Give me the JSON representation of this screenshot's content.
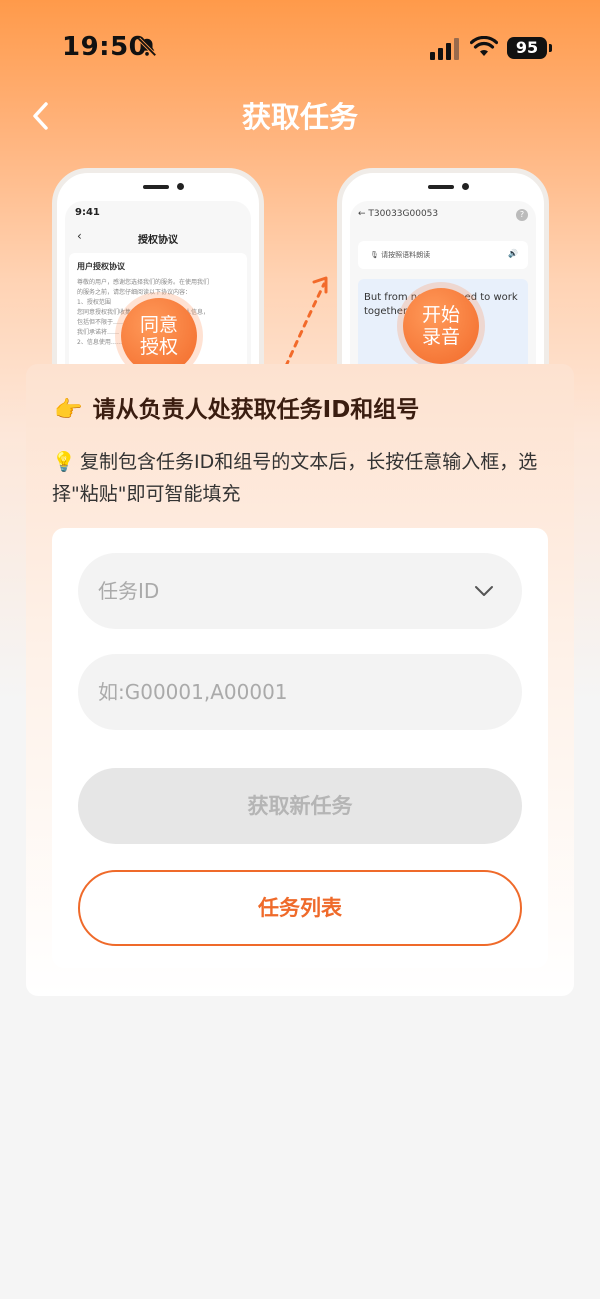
{
  "status_bar": {
    "time": "19:50",
    "battery": "95"
  },
  "nav": {
    "title": "获取任务"
  },
  "illustration": {
    "phone1": {
      "time": "9:41",
      "title": "授权协议",
      "card_heading": "用户授权协议",
      "card_text": [
        "尊敬的用户，感谢您选择我们的服务。在使用我们",
        "的服务之前，请您仔细阅读以下协议内容：",
        "1、授权范围",
        "您同意授权我们收集、使用和处理您的个人信息，",
        "包括但不限于……联系方式等",
        "我们承诺将……",
        "2、信息使用……"
      ],
      "bubble": [
        "同意",
        "授权"
      ]
    },
    "phone2": {
      "task_id": "T30033G00053",
      "help": "?",
      "prompt": "请按照语料朗读",
      "body_text": "But from now we need to work together.",
      "bubble": [
        "开始",
        "录音"
      ]
    }
  },
  "main": {
    "heading": "请从负责人处获取任务ID和组号",
    "hint": "复制包含任务ID和组号的文本后，长按任意输入框，选择\"粘贴\"即可智能填充",
    "task_id_placeholder": "任务ID",
    "group_placeholder": "如:G00001,A00001",
    "get_task_button": "获取新任务",
    "task_list_button": "任务列表"
  },
  "colors": {
    "accent": "#ef6a2a",
    "disabled_bg": "#e6e6e6",
    "disabled_text": "#b5b5b5"
  }
}
